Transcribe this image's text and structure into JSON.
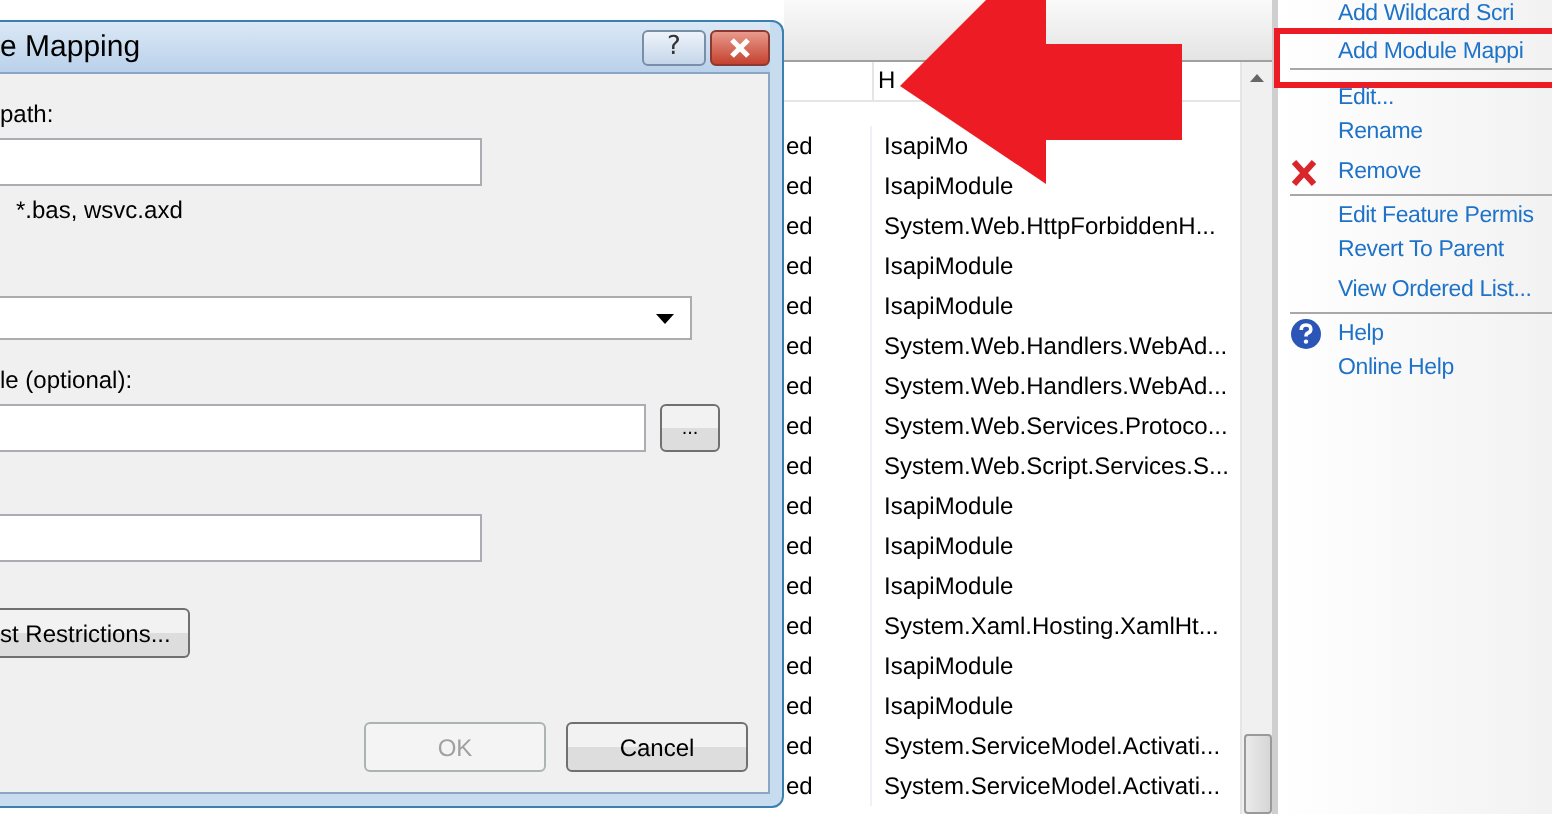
{
  "dialog": {
    "title": "e Mapping",
    "help_button": "?",
    "path_label": "path:",
    "example": "*.bas, wsvc.axd",
    "executable_label": "le (optional):",
    "browse_button": "...",
    "restrictions_button": "st Restrictions...",
    "ok_button": {
      "label": "OK",
      "disabled": true
    },
    "cancel_button": {
      "label": "Cancel",
      "disabled": false
    }
  },
  "list": {
    "columns": [
      "H"
    ],
    "rows": [
      {
        "cell_1": "ed",
        "cell_2": "IsapiMo"
      },
      {
        "cell_1": "ed",
        "cell_2": "IsapiModule"
      },
      {
        "cell_1": "ed",
        "cell_2": "System.Web.HttpForbiddenH..."
      },
      {
        "cell_1": "ed",
        "cell_2": "IsapiModule"
      },
      {
        "cell_1": "ed",
        "cell_2": "IsapiModule"
      },
      {
        "cell_1": "ed",
        "cell_2": "System.Web.Handlers.WebAd..."
      },
      {
        "cell_1": "ed",
        "cell_2": "System.Web.Handlers.WebAd..."
      },
      {
        "cell_1": "ed",
        "cell_2": "System.Web.Services.Protoco..."
      },
      {
        "cell_1": "ed",
        "cell_2": "System.Web.Script.Services.S..."
      },
      {
        "cell_1": "ed",
        "cell_2": "IsapiModule"
      },
      {
        "cell_1": "ed",
        "cell_2": "IsapiModule"
      },
      {
        "cell_1": "ed",
        "cell_2": "IsapiModule"
      },
      {
        "cell_1": "ed",
        "cell_2": "System.Xaml.Hosting.XamlHt..."
      },
      {
        "cell_1": "ed",
        "cell_2": "IsapiModule"
      },
      {
        "cell_1": "ed",
        "cell_2": "IsapiModule"
      },
      {
        "cell_1": "ed",
        "cell_2": "System.ServiceModel.Activati..."
      },
      {
        "cell_1": "ed",
        "cell_2": "System.ServiceModel.Activati..."
      }
    ]
  },
  "actions": [
    {
      "items": [
        {
          "label": "Add Wildcard Scri",
          "kind": "plain"
        }
      ]
    },
    {
      "items": [
        {
          "label": "Add Module Mappi",
          "kind": "plain",
          "highlighted": true
        }
      ]
    },
    {
      "items": [
        {
          "label": "Edit...",
          "kind": "plain"
        },
        {
          "label": "Rename",
          "kind": "plain"
        },
        {
          "label": "Remove",
          "kind": "remove"
        }
      ]
    },
    {
      "items": [
        {
          "label": "Edit Feature Permis",
          "kind": "plain"
        },
        {
          "label": "Revert To Parent",
          "kind": "plain"
        },
        {
          "label": "View Ordered List...",
          "kind": "plain"
        }
      ]
    },
    {
      "items": [
        {
          "label": "Help",
          "kind": "help"
        },
        {
          "label": "Online Help",
          "kind": "plain"
        }
      ]
    }
  ]
}
